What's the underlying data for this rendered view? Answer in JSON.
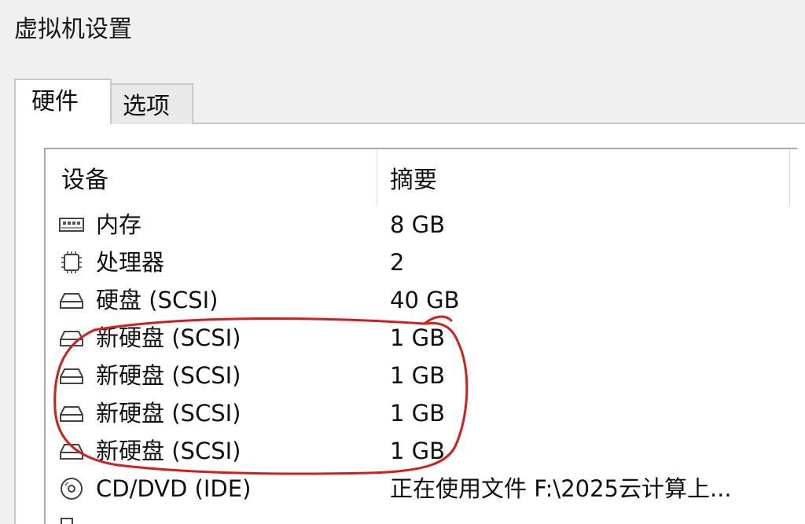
{
  "window": {
    "title": "虚拟机设置"
  },
  "tabs": [
    {
      "label": "硬件",
      "active": true
    },
    {
      "label": "选项",
      "active": false
    }
  ],
  "device_list": {
    "headers": {
      "device": "设备",
      "summary": "摘要"
    },
    "rows": [
      {
        "icon": "memory-icon",
        "name": "内存",
        "summary": "8 GB"
      },
      {
        "icon": "processor-icon",
        "name": "处理器",
        "summary": "2"
      },
      {
        "icon": "hard-disk-icon",
        "name": "硬盘 (SCSI)",
        "summary": "40 GB"
      },
      {
        "icon": "hard-disk-icon",
        "name": "新硬盘 (SCSI)",
        "summary": "1 GB"
      },
      {
        "icon": "hard-disk-icon",
        "name": "新硬盘 (SCSI)",
        "summary": "1 GB"
      },
      {
        "icon": "hard-disk-icon",
        "name": "新硬盘 (SCSI)",
        "summary": "1 GB"
      },
      {
        "icon": "hard-disk-icon",
        "name": "新硬盘 (SCSI)",
        "summary": "1 GB"
      },
      {
        "icon": "cd-dvd-icon",
        "name": "CD/DVD (IDE)",
        "summary": "正在使用文件 F:\\2025云计算上..."
      }
    ]
  },
  "annotation": {
    "color": "#d11f1f"
  }
}
